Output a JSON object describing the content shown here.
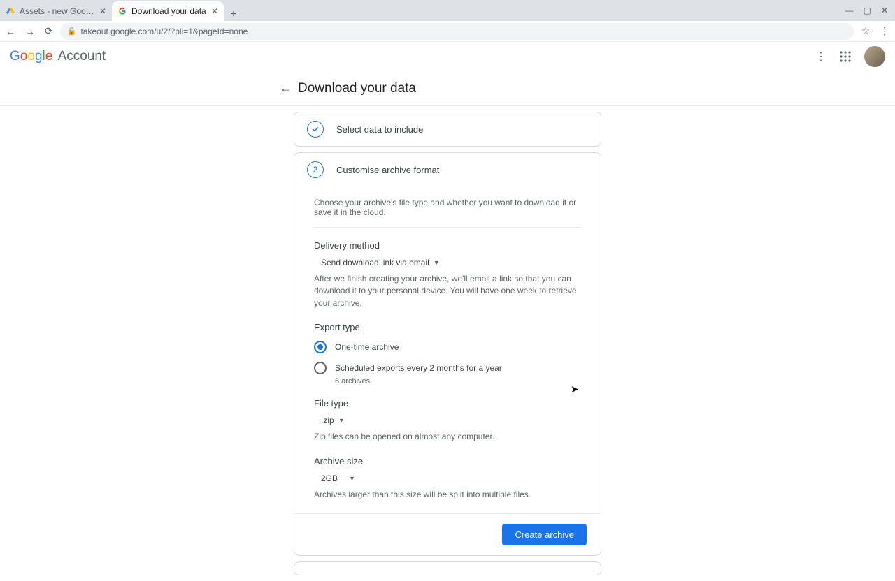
{
  "browser": {
    "tabs": [
      {
        "title": "Assets - new Google Sites - Goo"
      },
      {
        "title": "Download your data"
      }
    ],
    "url": "takeout.google.com/u/2/?pli=1&pageId=none"
  },
  "header": {
    "account_label": "Account"
  },
  "page": {
    "title": "Download your data"
  },
  "step1": {
    "title": "Select data to include"
  },
  "step2": {
    "number": "2",
    "title": "Customise archive format",
    "intro": "Choose your archive's file type and whether you want to download it or save it in the cloud.",
    "delivery": {
      "label": "Delivery method",
      "value": "Send download link via email",
      "hint": "After we finish creating your archive, we'll email a link so that you can download it to your personal device. You will have one week to retrieve your archive."
    },
    "export_type": {
      "label": "Export type",
      "opt1": "One-time archive",
      "opt2": "Scheduled exports every 2 months for a year",
      "opt2_sub": "6 archives"
    },
    "file_type": {
      "label": "File type",
      "value": ".zip",
      "hint": "Zip files can be opened on almost any computer."
    },
    "archive_size": {
      "label": "Archive size",
      "value": "2GB",
      "hint": "Archives larger than this size will be split into multiple files."
    },
    "create_button": "Create archive"
  }
}
